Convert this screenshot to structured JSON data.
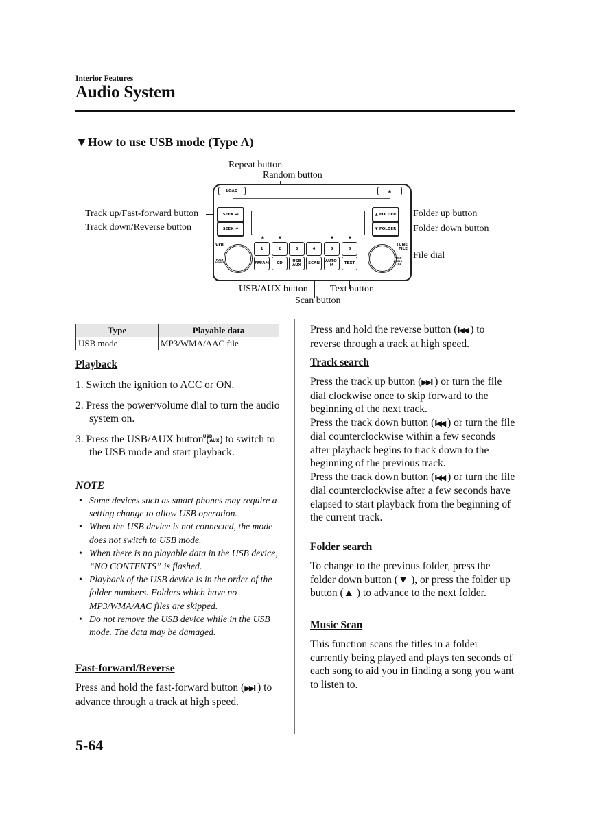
{
  "header": {
    "section": "Interior Features",
    "title": "Audio System"
  },
  "subsection_title": "How to use USB mode (Type A)",
  "subsection_marker": "▼",
  "diagram": {
    "callouts": {
      "repeat": "Repeat button",
      "random": "Random button",
      "track_up": "Track up/Fast-forward button",
      "track_down": "Track down/Reverse button",
      "folder_up": "Folder up button",
      "folder_down": "Folder down button",
      "file_dial": "File dial",
      "usb_aux": "USB/AUX button",
      "text": "Text button",
      "scan": "Scan button"
    },
    "radio": {
      "load": "LOAD",
      "eject": "▲",
      "seek_up": "SEEK ⏭",
      "seek_down": "SEEK ⏮",
      "folder_up": "▲ FOLDER",
      "folder_down": "▼ FOLDER",
      "vol": "VOL",
      "push_power": "PUSH POWER",
      "tune_file": "TUNE FILE",
      "push_audio_ctrl": "PUSH AUDIO CTRL",
      "presets": [
        "1",
        "2",
        "3",
        "4",
        "5",
        "6"
      ],
      "functions": [
        "FM/AM",
        "CD",
        "USB AUX",
        "SCAN",
        "AUTO-M",
        "TEXT"
      ]
    }
  },
  "table": {
    "headers": [
      "Type",
      "Playable data"
    ],
    "rows": [
      [
        "USB mode",
        "MP3/WMA/AAC file"
      ]
    ]
  },
  "playback": {
    "title": "Playback",
    "steps": [
      "1. Switch the ignition to ACC or ON.",
      "2. Press the power/volume dial to turn the audio system on.",
      "3. Press the USB/AUX button (",
      ") to switch to the USB mode and start playback."
    ],
    "usb_aux_icon_top": "USB",
    "usb_aux_icon_bottom": "AUX"
  },
  "note": {
    "title": "NOTE",
    "items": [
      "Some devices such as smart phones may require a setting change to allow USB operation.",
      "When the USB device is not connected, the mode does not switch to USB mode.",
      "When there is no playable data in the USB device, “NO CONTENTS” is flashed.",
      "Playback of the USB device is in the order of the folder numbers. Folders which have no MP3/WMA/AAC files are skipped.",
      "Do not remove the USB device while in the USB mode. The data may be damaged."
    ]
  },
  "fast_forward": {
    "title": "Fast-forward/Reverse",
    "text_a": "Press and hold the fast-forward button (",
    "text_b": " ) to advance through a track at high speed.",
    "reverse_a": "Press and hold the reverse button (",
    "reverse_b": " ) to reverse through a track at high speed."
  },
  "track_search": {
    "title": "Track search",
    "p1a": "Press the track up button (",
    "p1b": " ) or turn the file dial clockwise once to skip forward to the beginning of the next track.",
    "p2a": "Press the track down button (",
    "p2b": " ) or turn the file dial counterclockwise within a few seconds after playback begins to track down to the beginning of the previous track.",
    "p3a": "Press the track down button (",
    "p3b": " ) or turn the file dial counterclockwise after a few seconds have elapsed to start playback from the beginning of the current track."
  },
  "folder_search": {
    "title": "Folder search",
    "p_a": "To change to the previous folder, press the folder down button (",
    "p_b": " ), or press the folder up button (",
    "p_c": " ) to advance to the next folder.",
    "down_glyph": "▼",
    "up_glyph": "▲"
  },
  "music_scan": {
    "title": "Music Scan",
    "text": "This function scans the titles in a folder currently being played and plays ten seconds of each song to aid you in finding a song you want to listen to."
  },
  "glyphs": {
    "fast_forward": "▶▶I",
    "reverse": "I◀◀"
  },
  "page_number": "5-64"
}
